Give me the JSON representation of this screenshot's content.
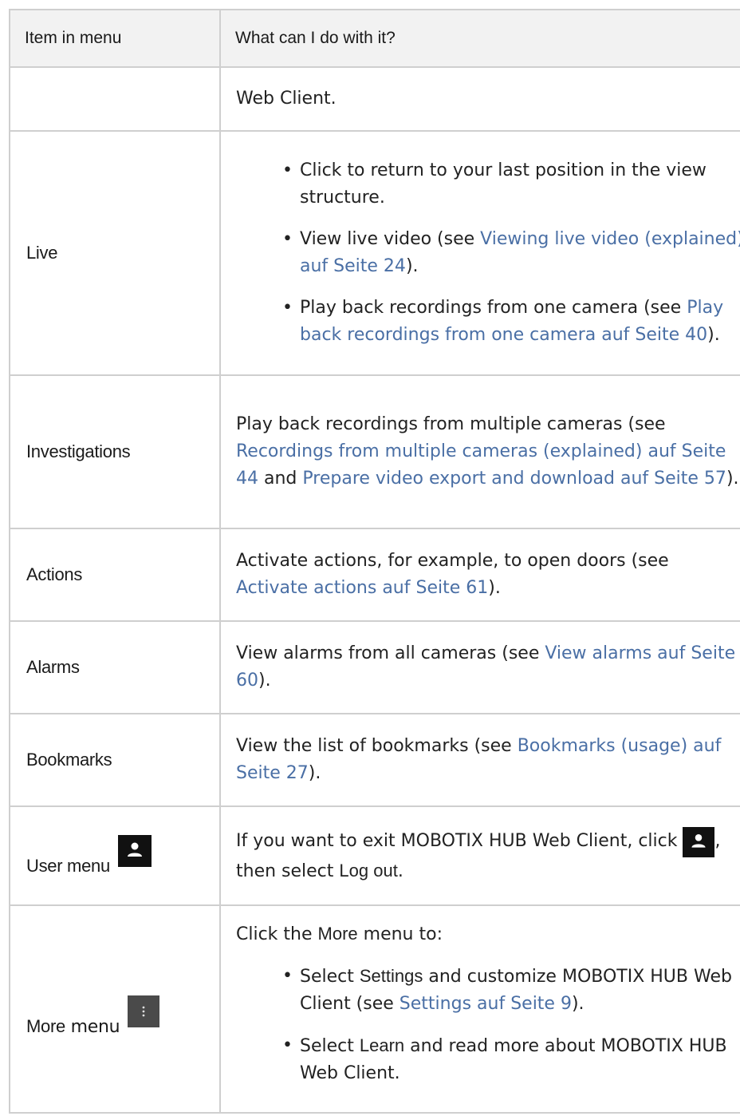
{
  "header": {
    "col1": "Item in menu",
    "col2": "What can I do with it?"
  },
  "rows": {
    "web_client": {
      "text": "Web Client."
    },
    "live": {
      "item": "Live",
      "b1": "Click to return to your last position in the view structure.",
      "b2_pre": "View live video (see ",
      "b2_link": "Viewing live video (explained) auf Seite 24",
      "b2_post": ").",
      "b3_pre": "Play back recordings from one camera (see ",
      "b3_link": "Play back recordings from one camera auf Seite 40",
      "b3_post": ")."
    },
    "investigations": {
      "item": "Investigations",
      "pre": "Play back recordings from multiple cameras (see ",
      "link1": "Recordings from multiple cameras (explained) auf Seite 44",
      "mid": " and ",
      "link2": "Prepare video export and download auf Seite 57",
      "post": ")."
    },
    "actions": {
      "item": "Actions",
      "pre": "Activate actions, for example, to open doors (see ",
      "link": "Activate actions auf Seite 61",
      "post": ")."
    },
    "alarms": {
      "item": "Alarms",
      "pre": "View alarms from all cameras (see ",
      "link": "View alarms auf Seite 60",
      "post": ")."
    },
    "bookmarks": {
      "item": "Bookmarks",
      "pre": "View the list of bookmarks (see ",
      "link": "Bookmarks (usage) auf Seite 27",
      "post": ")."
    },
    "user_menu": {
      "item": "User menu",
      "pre": "If you want to exit MOBOTIX HUB Web Client, click ",
      "mid": ", then select ",
      "bold": "Log out",
      "post": "."
    },
    "more_menu": {
      "item_bold": "More",
      "item_rest": " menu",
      "intro_pre": "Click the ",
      "intro_bold": "More",
      "intro_post": " menu to:",
      "b1_pre": "Select ",
      "b1_bold": "Settings",
      "b1_mid": " and customize MOBOTIX HUB Web Client (see ",
      "b1_link": "Settings auf Seite 9",
      "b1_post": ").",
      "b2_pre": "Select ",
      "b2_bold": "Learn",
      "b2_post": " and read more about MOBOTIX HUB Web Client."
    }
  },
  "colors": {
    "link": "#4a6fa5",
    "header_bg": "#f2f2f2",
    "border": "#cfcfcf"
  },
  "icons": {
    "user": "person-icon",
    "more": "vertical-dots-icon"
  }
}
